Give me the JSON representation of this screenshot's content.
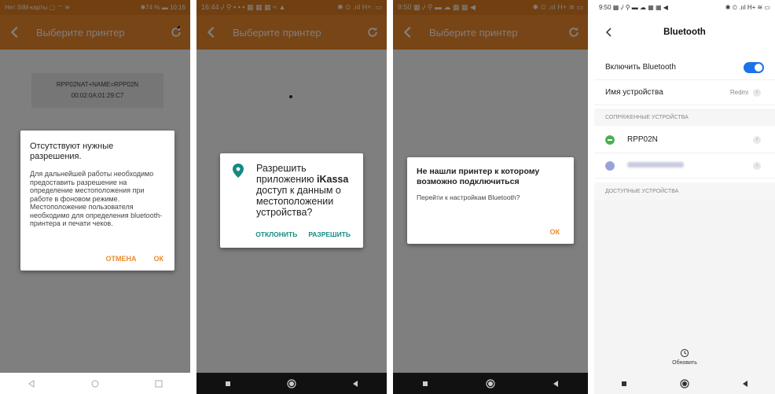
{
  "screen1": {
    "status_left": "Нет SIM-карты ▢ ⌔ ≋",
    "status_right": "✱74 % ▬ 10:16",
    "title": "Выберите принтер",
    "printer_name": "RPP02NAT+NAME=RPP02N",
    "printer_mac": "00:02:0A:01:29:C7",
    "dialog": {
      "title": "Отсутствуют нужные разрешения.",
      "body": "Для дальнейшей работы необходимо предоставить разрешение на определение местоположения при работе в фоновом режиме. Местоположение пользователя необходимо для определения bluetooth-принтера и печати чеков.",
      "cancel": "ОТМЕНА",
      "ok": "ОК"
    },
    "accent": "#ee8a2d"
  },
  "screen2": {
    "status_left": "16:44 ᵥᴵ ⚲ ▪ ▪ ▪ ▦ ▦ ▦ ≈ ▲",
    "status_right": "✱ ⏲ .ııl H+. ▭",
    "title": "Выберите принтер",
    "dialog": {
      "text_before": "Разрешить приложению ",
      "app_name": "iKassa",
      "text_after": " доступ к данным о местоположении устройства?",
      "deny": "ОТКЛОНИТЬ",
      "allow": "РАЗРЕШИТЬ"
    },
    "accent": "#168a82"
  },
  "screen3": {
    "status_left": "9:50 ▦ ᵥᴵ ⚲ ▬ ☁ ▦ ▦ ◀",
    "status_right": "✱ ⏲ .ııl H+ ≋ ▭",
    "title": "Выберите принтер",
    "dialog": {
      "title": "Не нашли принтер к которому возможно подключиться",
      "body": "Перейти к настройкам Bluetooth?",
      "ok": "ОК"
    }
  },
  "screen4": {
    "status_left": "9:50 ▦ ᵥᴵ ⚲ ▬ ☁ ▦ ▦ ◀",
    "status_right": "✱ ⏲ .ııl H+ ≋ ▭",
    "title": "Bluetooth",
    "enable_label": "Включить Bluetooth",
    "enable_on": true,
    "device_name_label": "Имя устройства",
    "device_name_value": "Redmi",
    "paired_section": "СОПРЯЖЕННЫЕ УСТРОЙСТВА",
    "paired": [
      {
        "name": "RPP02N",
        "icon_color": "#4caf50"
      },
      {
        "name": "",
        "icon_color": "#9aa0d8"
      }
    ],
    "available_section": "ДОСТУПНЫЕ УСТРОЙСТВА",
    "refresh_label": "Обновить",
    "accent": "#1a73e8"
  }
}
